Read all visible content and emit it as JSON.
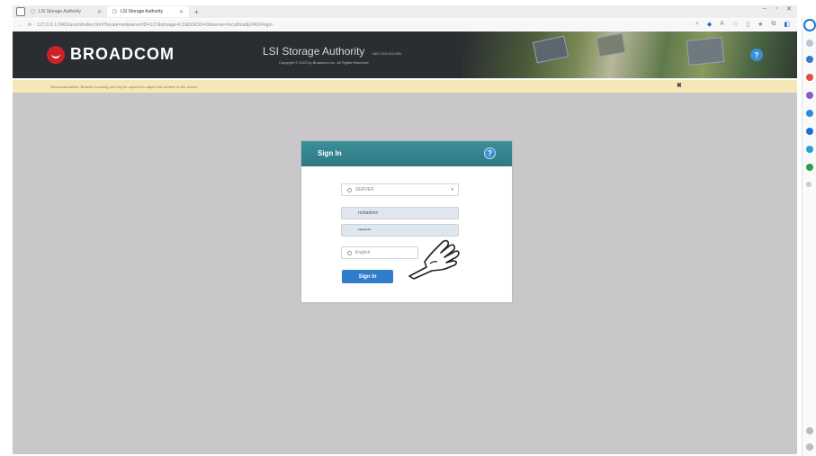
{
  "browser": {
    "tabs": [
      {
        "label": "LSI Storage Authority",
        "active": false
      },
      {
        "label": "LSI Storage Authority",
        "active": true
      }
    ],
    "new_tab_label": "+",
    "url": "127.0.0.1:2463/ucsm/index.html?locale=en&serverID=127&storage=LSI&SSOID=0&server=localhost&2463#login",
    "window_controls": [
      "–",
      "▫",
      "✕"
    ]
  },
  "banner": {
    "brand": "BROADCOM",
    "product_name": "LSI Storage Authority",
    "product_version": "v007.023.014.000",
    "copyright": "Copyright © 2022 by Broadcom Inc. All Rights Reserved",
    "help_glyph": "?"
  },
  "warning": {
    "text": "Recommendation: Browser zooming out may be required to adjust the content on the screen.",
    "close_glyph": "✖"
  },
  "login": {
    "title": "Sign In",
    "help_glyph": "?",
    "host_value": "SERVER",
    "username_value": "rootadmin",
    "password_value": "••••••••",
    "language_value": "English",
    "submit_label": "Sign In"
  },
  "colors": {
    "banner_bg": "#2a2d31",
    "brand_red": "#cc2229",
    "dialog_header": "#3b8f99",
    "button_blue": "#2f7ccd",
    "warning_bg": "#f4e9b6",
    "page_bg": "#c9c7c9"
  },
  "icons": [
    "window-icon",
    "page-icon",
    "refresh-icon",
    "help-icon",
    "close-icon",
    "host-icon",
    "globe-icon",
    "chevron-down-icon",
    "pointer-hand-icon",
    "copilot-icon"
  ]
}
